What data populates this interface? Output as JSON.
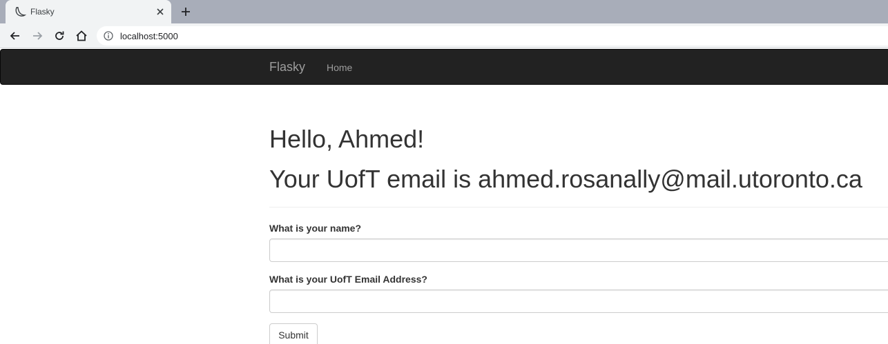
{
  "browser": {
    "tab_title": "Flasky",
    "url": "localhost:5000"
  },
  "navbar": {
    "brand": "Flasky",
    "home_link": "Home"
  },
  "main": {
    "greeting": "Hello, Ahmed!",
    "email_line": "Your UofT email is ahmed.rosanally@mail.utoronto.ca"
  },
  "form": {
    "name_label": "What is your name?",
    "name_value": "",
    "email_label": "What is your UofT Email Address?",
    "email_value": "",
    "submit_label": "Submit"
  },
  "colors": {
    "navbar_bg": "#222222",
    "navbar_text": "#9d9d9d",
    "heading_text": "#333333"
  }
}
